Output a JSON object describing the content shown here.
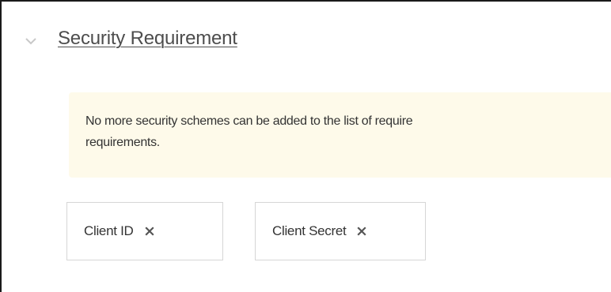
{
  "section": {
    "title": "Security Requirement",
    "icon": "chevron-down-icon"
  },
  "notice": {
    "line1": "No more security schemes can be added to the list of require",
    "line2": "requirements.",
    "background_color": "#fefaea"
  },
  "chips": [
    {
      "label": "Client ID",
      "remove_icon": "close-icon"
    },
    {
      "label": "Client Secret",
      "remove_icon": "close-icon"
    }
  ]
}
